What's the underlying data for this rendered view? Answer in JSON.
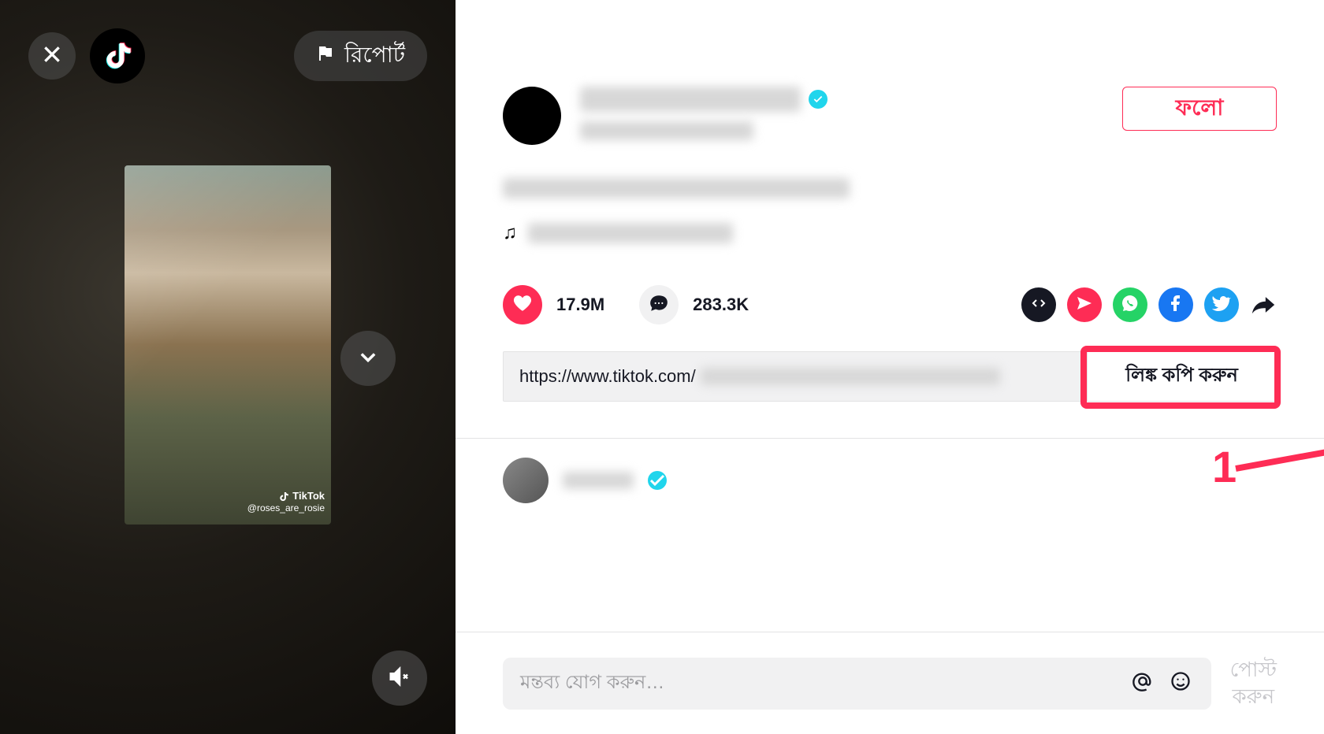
{
  "video_panel": {
    "report_label": "রিপোর্ট",
    "watermark_brand": "TikTok",
    "watermark_handle": "@roses_are_rosie"
  },
  "profile": {
    "follow_label": "ফলো"
  },
  "stats": {
    "likes": "17.9M",
    "comments": "283.3K"
  },
  "link": {
    "url_prefix": "https://www.tiktok.com/",
    "copy_label": "লিঙ্ক কপি করুন"
  },
  "comment_input": {
    "placeholder": "মন্তব্য যোগ করুন…",
    "post_label": "পোস্ট\nকরুন"
  },
  "annotation": {
    "step": "1"
  }
}
